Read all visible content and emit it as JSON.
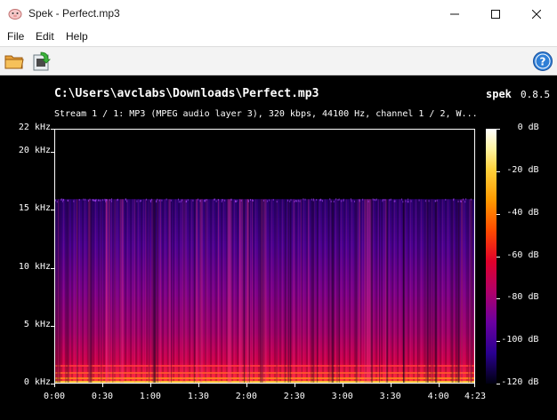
{
  "window": {
    "title": "Spek - Perfect.mp3"
  },
  "menu": {
    "items": [
      "File",
      "Edit",
      "Help"
    ]
  },
  "toolbar": {
    "open_icon": "folder-open-icon",
    "save_icon": "save-image-icon",
    "help_icon": "help-icon"
  },
  "header": {
    "file_path": "C:\\Users\\avclabs\\Downloads\\Perfect.mp3",
    "app_name": "spek",
    "version": "0.8.5",
    "stream_info": "Stream 1 / 1: MP3 (MPEG audio layer 3), 320 kbps, 44100 Hz, channel 1 / 2, W..."
  },
  "axes": {
    "y_ticks": [
      {
        "label": "22 kHz",
        "khz": 22
      },
      {
        "label": "20 kHz",
        "khz": 20
      },
      {
        "label": "15 kHz",
        "khz": 15
      },
      {
        "label": "10 kHz",
        "khz": 10
      },
      {
        "label": "5 kHz",
        "khz": 5
      },
      {
        "label": "0 kHz",
        "khz": 0
      }
    ],
    "x_ticks": [
      {
        "label": "0:00",
        "sec": 0
      },
      {
        "label": "0:30",
        "sec": 30
      },
      {
        "label": "1:00",
        "sec": 60
      },
      {
        "label": "1:30",
        "sec": 90
      },
      {
        "label": "2:00",
        "sec": 120
      },
      {
        "label": "2:30",
        "sec": 150
      },
      {
        "label": "3:00",
        "sec": 180
      },
      {
        "label": "3:30",
        "sec": 210
      },
      {
        "label": "4:00",
        "sec": 240
      },
      {
        "label": "4:23",
        "sec": 263
      }
    ],
    "db_ticks": [
      {
        "label": "0 dB",
        "db": 0
      },
      {
        "label": "-20 dB",
        "db": -20
      },
      {
        "label": "-40 dB",
        "db": -40
      },
      {
        "label": "-60 dB",
        "db": -60
      },
      {
        "label": "-80 dB",
        "db": -80
      },
      {
        "label": "-100 dB",
        "db": -100
      },
      {
        "label": "-120 dB",
        "db": -120
      }
    ],
    "y_max_khz": 22,
    "x_max_sec": 263,
    "db_range": [
      -120,
      0
    ]
  },
  "spectrogram": {
    "cutoff_khz": 16
  }
}
